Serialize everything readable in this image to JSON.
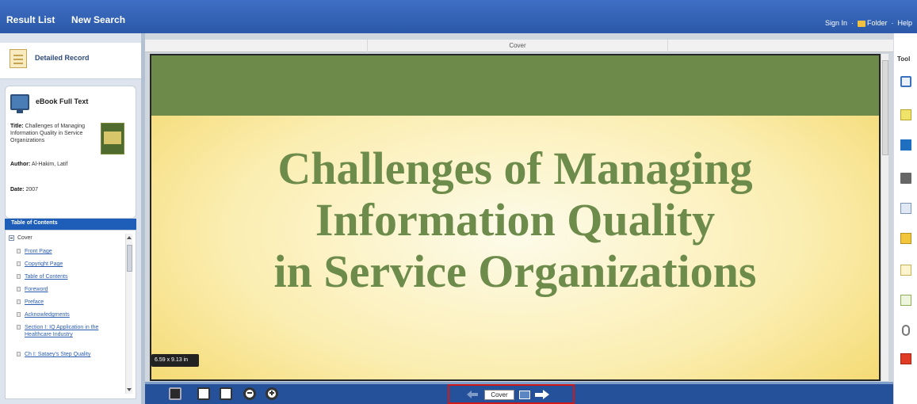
{
  "header": {
    "result_list": "Result List",
    "new_search": "New Search",
    "sign_in": "Sign In",
    "folder": "Folder",
    "help": "Help"
  },
  "left": {
    "detailed_record": "Detailed Record",
    "ebook_full_text": "eBook Full Text",
    "title_label": "Title:",
    "title_value": "Challenges of Managing Information Quality in Service Organizations",
    "author_label": "Author:",
    "author_value": "Al-Hakim, Latif",
    "date_label": "Date:",
    "date_value": "2007",
    "toc_heading": "Table of Contents",
    "toc_root": "Cover",
    "toc_items": [
      "Front Page",
      "Copyright Page",
      "Table of Contents",
      "Foreword",
      "Preface",
      "Acknowledgments",
      "Section I: IQ Application in the Healthcare Industry",
      "Ch I: Sataey's Step Quality"
    ]
  },
  "viewer": {
    "tab_label": "Cover",
    "cover_lines": [
      "Challenges of Managing",
      "Information Quality",
      "in Service Organizations"
    ],
    "page_size": "6.59 x 9.13 in",
    "page_field": "Cover"
  },
  "tools": {
    "label": "Tool",
    "icons": [
      "search-icon",
      "note-icon",
      "dictionary-icon",
      "print-icon",
      "email-icon",
      "save-icon",
      "cite-icon",
      "export-icon",
      "permalink-icon",
      "pdf-icon"
    ]
  },
  "colors": {
    "header_blue": "#2b58a8",
    "cover_green": "#6e8a4a",
    "cover_yellow": "#fbeeb2",
    "nav_highlight": "#d01818"
  }
}
